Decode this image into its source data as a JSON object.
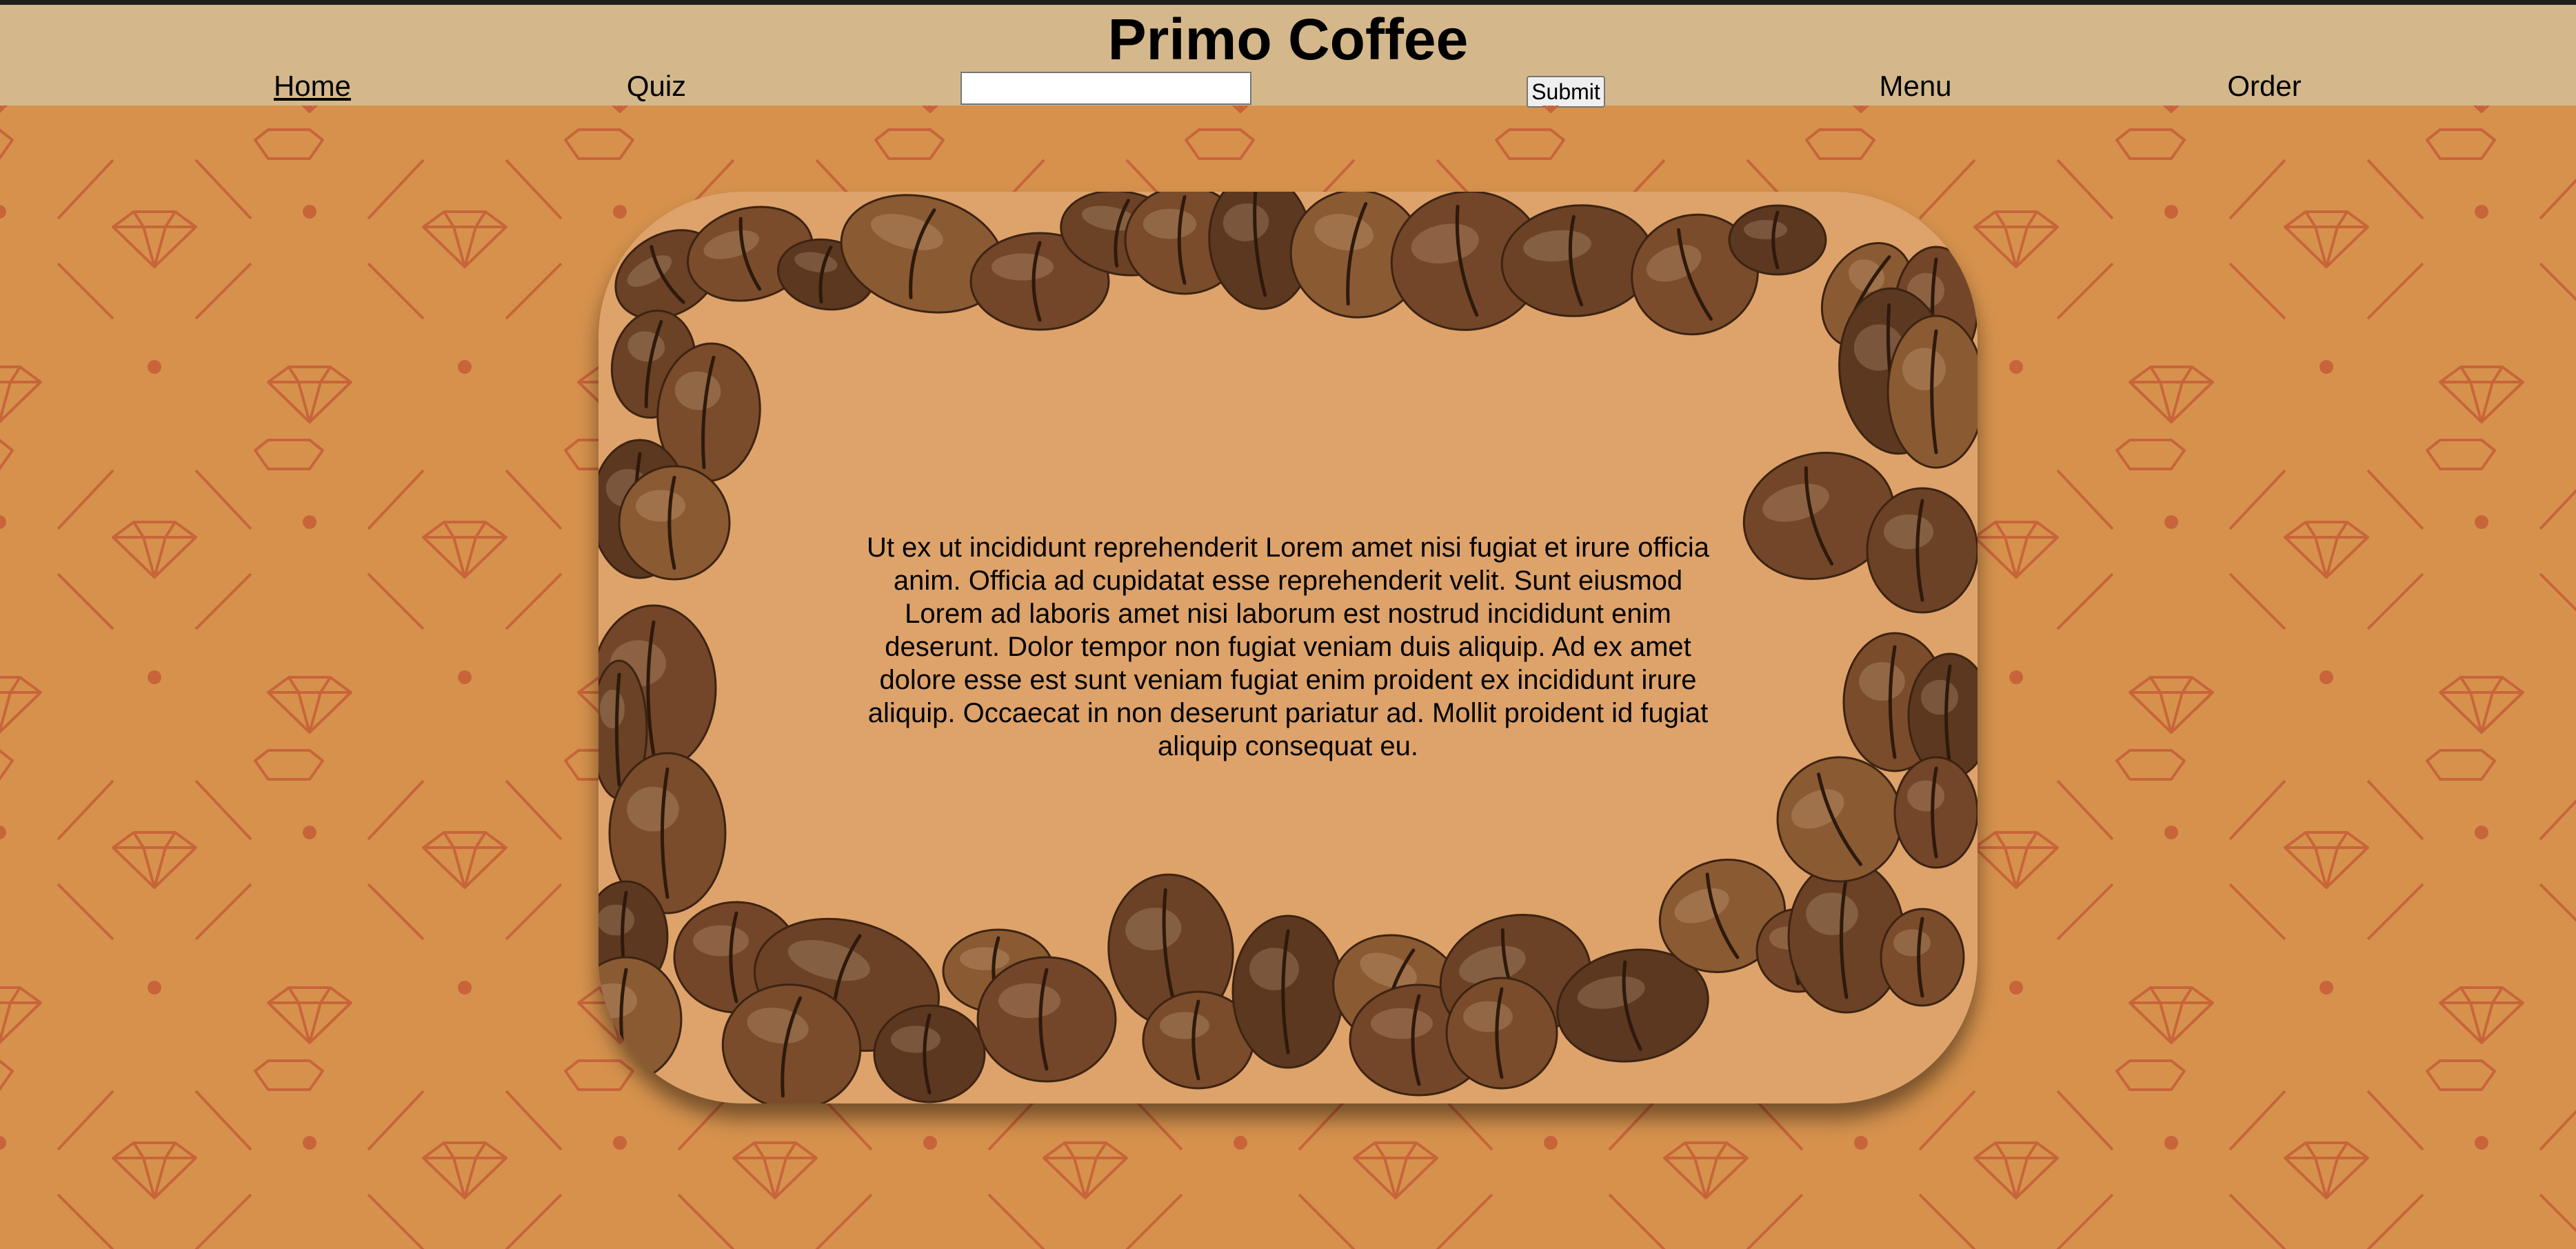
{
  "header": {
    "title": "Primo Coffee",
    "nav": {
      "home": "Home",
      "quiz": "Quiz",
      "search_value": "",
      "submit_label": "Submit",
      "menu": "Menu",
      "order": "Order"
    }
  },
  "hero": {
    "text": "Ut ex ut incididunt reprehenderit Lorem amet nisi fugiat et irure officia anim. Officia ad cupidatat esse reprehenderit velit. Sunt eiusmod Lorem ad laboris amet nisi laborum est nostrud incididunt enim deserunt. Dolor tempor non fugiat veniam duis aliquip. Ad ex amet dolore esse est sunt veniam fugiat enim proident ex incididunt irure aliquip. Occaecat in non deserunt pariatur ad. Mollit proident id fugiat aliquip consequat eu."
  },
  "icons": {
    "background_pattern": "diamond-icon",
    "frame_decoration": "coffee-bean-icon"
  },
  "colors": {
    "page_background": "#d6924d",
    "header_background": "#d4b88c",
    "pattern_stroke": "#c8643a",
    "frame_fill": "#dea36b",
    "bean_brown": "#6b4226"
  }
}
